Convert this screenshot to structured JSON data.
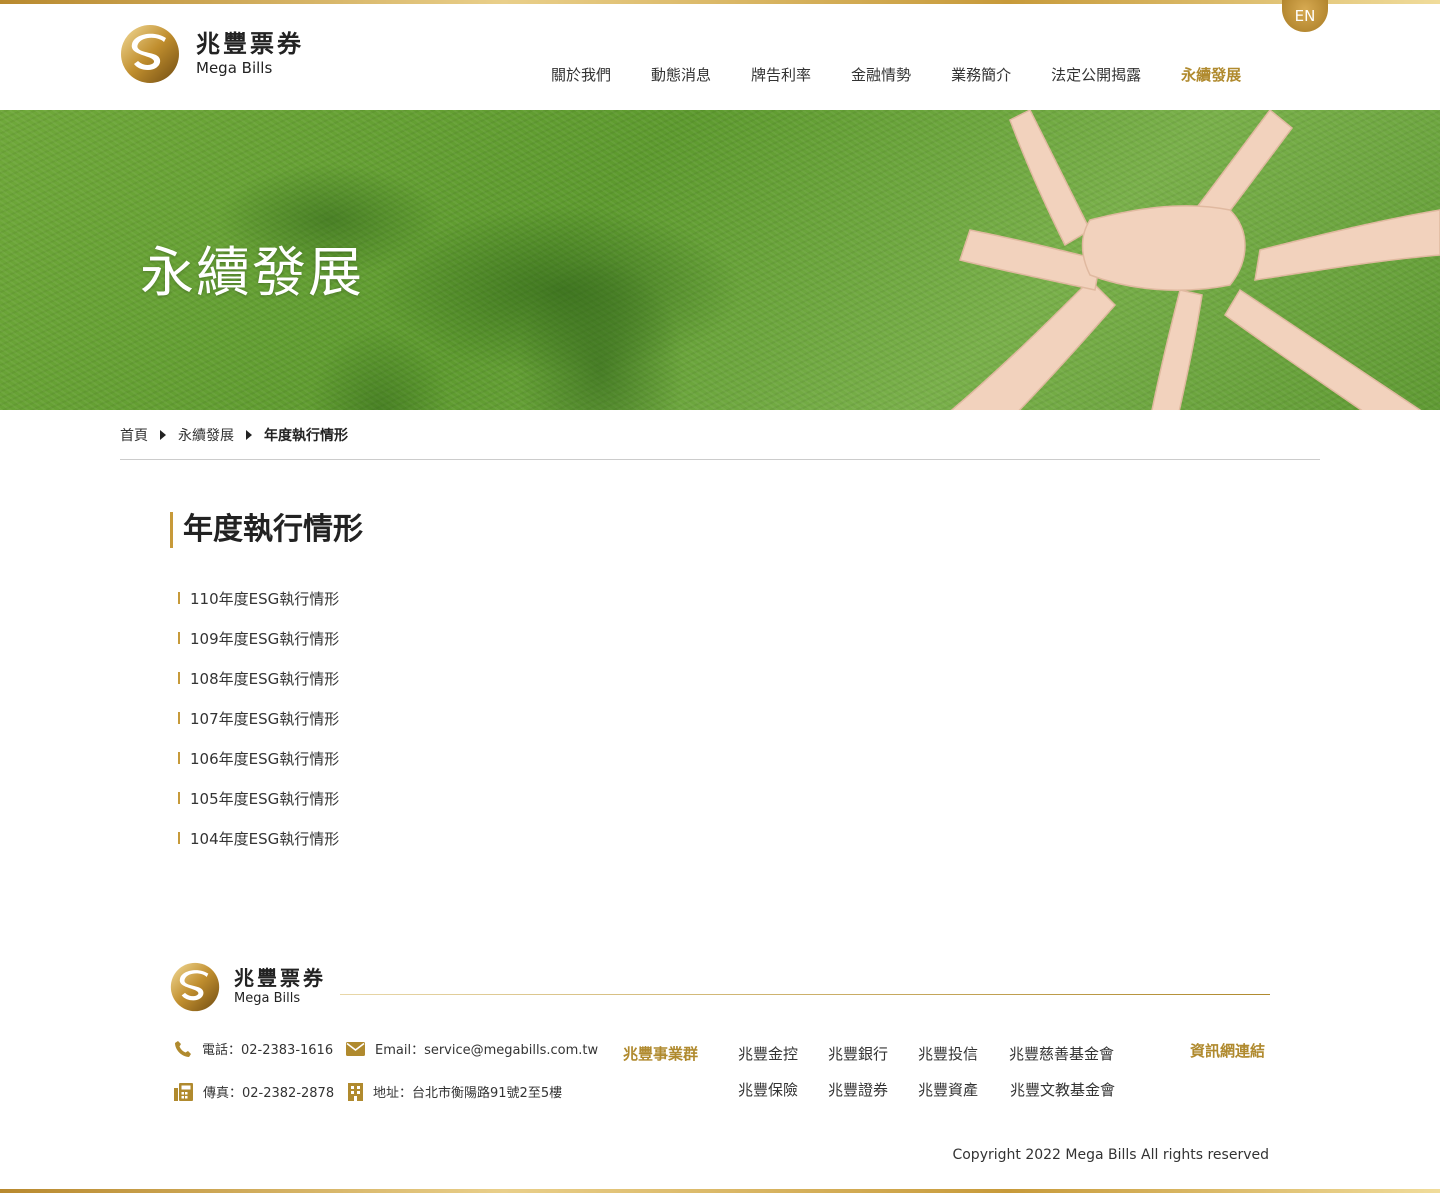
{
  "brand": {
    "name_zh": "兆豐票券",
    "name_en": "Mega Bills"
  },
  "header": {
    "lang_button": "EN"
  },
  "nav": [
    {
      "label": "關於我們",
      "active": false
    },
    {
      "label": "動態消息",
      "active": false
    },
    {
      "label": "牌告利率",
      "active": false
    },
    {
      "label": "金融情勢",
      "active": false
    },
    {
      "label": "業務簡介",
      "active": false
    },
    {
      "label": "法定公開揭露",
      "active": false
    },
    {
      "label": "永續發展",
      "active": true
    }
  ],
  "banner": {
    "title": "永續發展"
  },
  "breadcrumb": [
    {
      "label": "首頁"
    },
    {
      "label": "永續發展"
    },
    {
      "label": "年度執行情形"
    }
  ],
  "page": {
    "title": "年度執行情形"
  },
  "reports": [
    "110年度ESG執行情形",
    "109年度ESG執行情形",
    "108年度ESG執行情形",
    "107年度ESG執行情形",
    "106年度ESG執行情形",
    "105年度ESG執行情形",
    "104年度ESG執行情形"
  ],
  "footer": {
    "phone": "電話：02-2383-1616",
    "email": "Email：service@megabills.com.tw",
    "fax": "傳真：02-2382-2878",
    "address": "地址：台北市衡陽路91號2至5樓",
    "group_title": "兆豐事業群",
    "group_links": [
      "兆豐金控",
      "兆豐銀行",
      "兆豐投信",
      "兆豐慈善基金會",
      "兆豐保險",
      "兆豐證券",
      "兆豐資產",
      "兆豐文教基金會"
    ],
    "links_title": "資訊網連結",
    "copyright": "Copyright 2022 Mega Bills All rights reserved"
  },
  "colors": {
    "accent_gold": "#b08a2e",
    "text": "#333333",
    "divider": "#cccccc"
  }
}
